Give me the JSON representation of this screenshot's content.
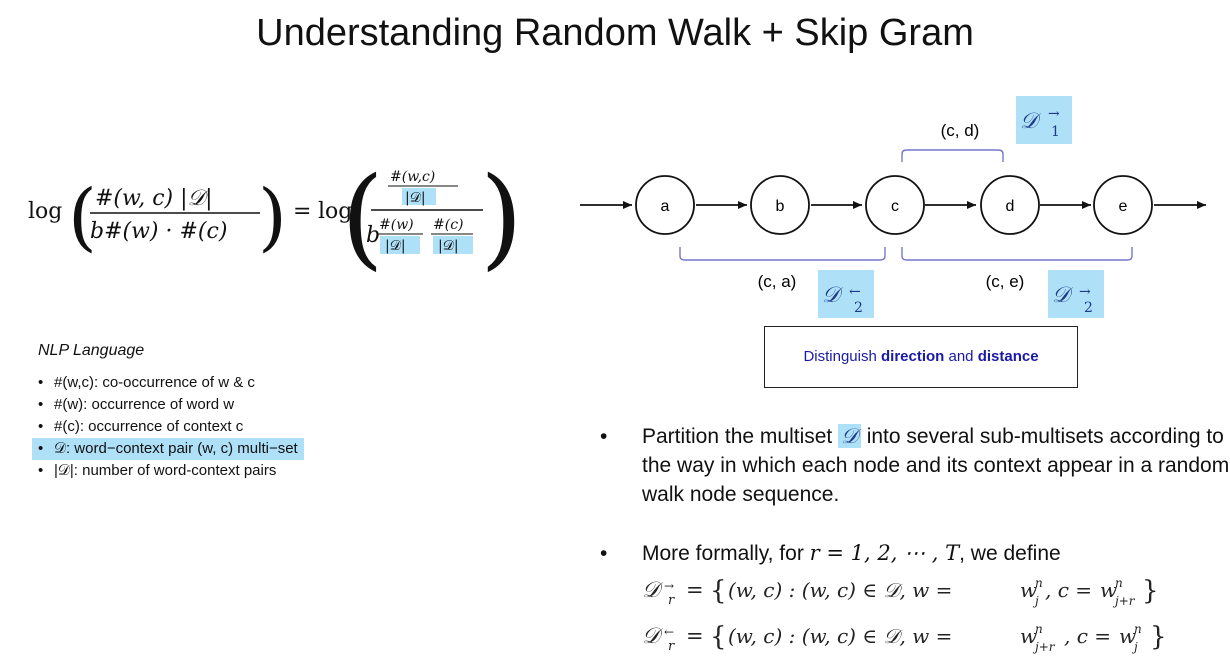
{
  "title": "Understanding Random Walk + Skip Gram",
  "formula": {
    "log": "log",
    "equals": "=",
    "lhs_num": "#(w, c) |𝒟|",
    "lhs_den": "b#(w) · #(c)",
    "rhs_num_num": "#(w,c)",
    "rhs_num_den": "|𝒟|",
    "rhs_b": "b",
    "rhs_den_a_num": "#(w)",
    "rhs_den_a_den": "|𝒟|",
    "rhs_den_b_num": "#(c)",
    "rhs_den_b_den": "|𝒟|"
  },
  "nlp": {
    "title": "NLP Language",
    "bullet": "•",
    "items": [
      "#(w,c): co-occurrence of w & c",
      "#(w): occurrence of word w",
      "#(c): occurrence of context c",
      "𝒟: word−context pair (w, c) multi−set",
      "|𝒟|: number of word-context pairs"
    ]
  },
  "diagram": {
    "nodes": [
      "a",
      "b",
      "c",
      "d",
      "e"
    ],
    "pair_cd": "(c, d)",
    "pair_ca": "(c, a)",
    "pair_ce": "(c, e)",
    "d_symbol": "𝒟",
    "sub_1": "1",
    "sub_2": "2",
    "arrow_right": "→",
    "arrow_left": "←"
  },
  "distinguish": {
    "prefix": "Distinguish ",
    "word1": "direction",
    "middle": " and ",
    "word2": "distance"
  },
  "bullets": {
    "mark": "•",
    "b1_before": "Partition the multiset ",
    "b1_symbol": "𝒟",
    "b1_after": " into several sub-multisets according to the way in which each node and its context appear in a random walk node sequence.",
    "b2_before": "More formally, for ",
    "b2_math": "r = 1, 2, ⋯ , T",
    "b2_after": ", we define"
  },
  "definitions": {
    "def1": "𝒟→r = {(w, c) : (w, c) ∈ 𝒟, w = wⁿⱼ, c = wⁿⱼ₊ᵣ}",
    "def2": "𝒟←r = {(w, c) : (w, c) ∈ 𝒟, w = wⁿⱼ₊ᵣ, c = wⁿⱼ}",
    "set_open": "{",
    "set_close": "}",
    "body": "(w, c) : (w, c) ∈ 𝒟, w = ",
    "w": "w",
    "n": "n",
    "j": "j",
    "jr": "j+r",
    "c_eq": ", c = ",
    "r": "r"
  },
  "colors": {
    "highlight": "#aee0f8",
    "d_label": "#1f3a8a",
    "distinguish_text": "#1a1aa8",
    "bracket": "#7777cc"
  }
}
